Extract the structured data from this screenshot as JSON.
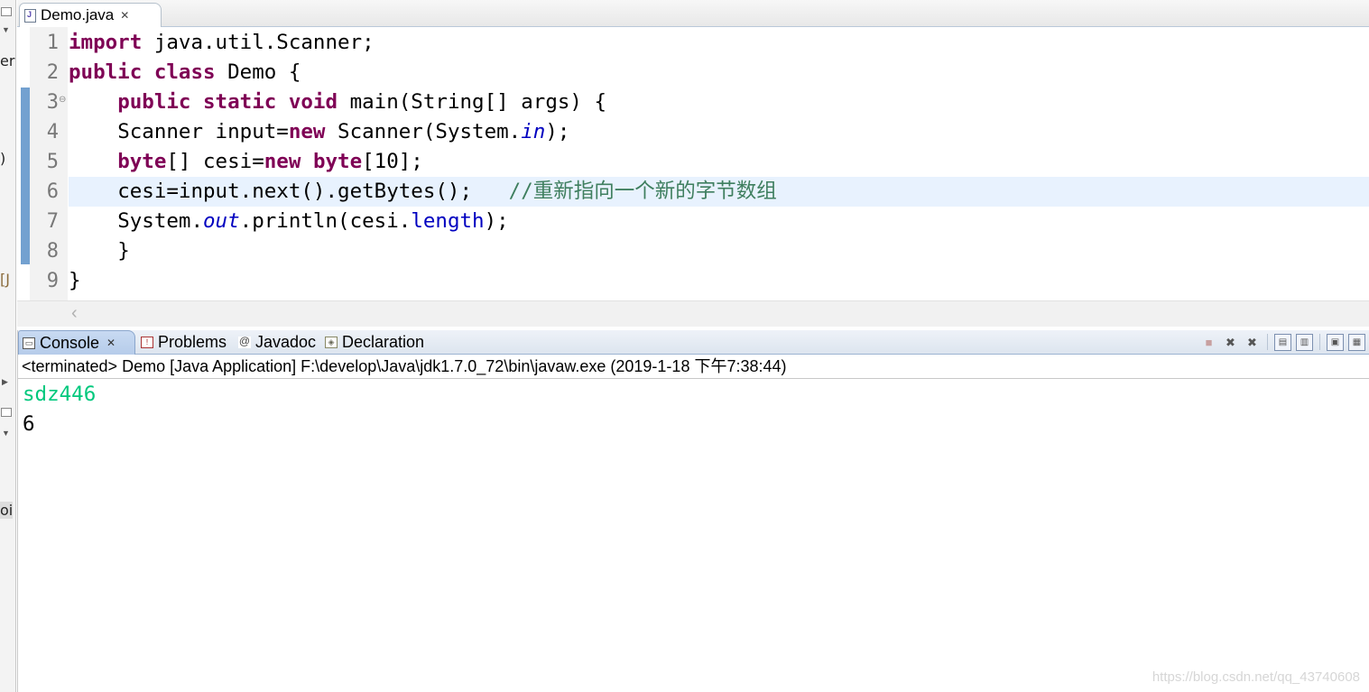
{
  "editor": {
    "tab_label": "Demo.java",
    "tab_close": "✕",
    "lines": [
      {
        "no": "1"
      },
      {
        "no": "2"
      },
      {
        "no": "3",
        "fold": "⊖"
      },
      {
        "no": "4"
      },
      {
        "no": "5"
      },
      {
        "no": "6"
      },
      {
        "no": "7"
      },
      {
        "no": "8"
      },
      {
        "no": "9"
      }
    ],
    "code": {
      "l1_kw": "import",
      "l1_rest": " java.util.Scanner;",
      "l2_kw1": "public",
      "l2_kw2": "class",
      "l2_rest": " Demo {",
      "l3_kw1": "public",
      "l3_kw2": "static",
      "l3_kw3": "void",
      "l3_rest": " main(String[] args) {",
      "l4_a": "Scanner input=",
      "l4_kw": "new",
      "l4_b": " Scanner(System.",
      "l4_fld": "in",
      "l4_c": ");",
      "l5_kw1": "byte",
      "l5_a": "[] cesi=",
      "l5_kw2": "new",
      "l5_kw3": "byte",
      "l5_b": "[10];",
      "l6_a": "cesi=input.next().getBytes();",
      "l6_cmt": "//重新指向一个新的字节数组",
      "l7_a": "System.",
      "l7_fld": "out",
      "l7_b": ".println(cesi.",
      "l7_fld2": "length",
      "l7_c": ");",
      "l8": "}",
      "l9": "}"
    }
  },
  "console": {
    "tabs": [
      {
        "label": "Console",
        "icon": "console-icon",
        "close": "✕"
      },
      {
        "label": "Problems",
        "icon": "problems-icon"
      },
      {
        "label": "Javadoc",
        "icon": "javadoc-icon"
      },
      {
        "label": "Declaration",
        "icon": "declaration-icon"
      }
    ],
    "header": "<terminated> Demo [Java Application] F:\\develop\\Java\\jdk1.7.0_72\\bin\\javaw.exe (2019-1-18 下午7:38:44)",
    "output": [
      {
        "text": "sdz446",
        "kind": "input"
      },
      {
        "text": "6",
        "kind": "stdout"
      }
    ]
  },
  "left_panel": {
    "frag1": "er",
    "frag2": ")",
    "frag3": "[J",
    "frag4": "oi"
  },
  "watermark": "https://blog.csdn.net/qq_43740608",
  "colors": {
    "keyword": "#7f0055",
    "field": "#0000c0",
    "comment": "#3f7f5f",
    "console_input": "#00c87d",
    "current_line": "#e8f2fe"
  }
}
